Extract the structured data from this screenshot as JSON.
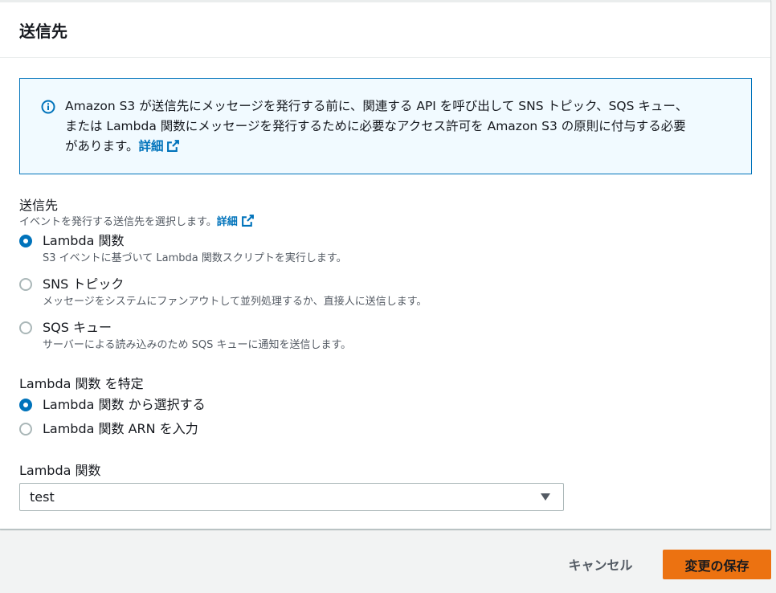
{
  "panel": {
    "title": "送信先"
  },
  "info": {
    "icon": "info-icon",
    "line1": "Amazon S3 が送信先にメッセージを発行する前に、関連する API を呼び出して SNS トピック、SQS キュー、",
    "line2": "または Lambda 関数にメッセージを発行するために必要なアクセス許可を Amazon S3 の原則に付与する必要",
    "line3": "があります。",
    "link": "詳細"
  },
  "destination": {
    "label": "送信先",
    "description": "イベントを発行する送信先を選択します。",
    "link": "詳細",
    "options": [
      {
        "label": "Lambda 関数",
        "description": "S3 イベントに基づいて Lambda 関数スクリプトを実行します。",
        "checked": true
      },
      {
        "label": "SNS トピック",
        "description": "メッセージをシステムにファンアウトして並列処理するか、直接人に送信します。",
        "checked": false
      },
      {
        "label": "SQS キュー",
        "description": "サーバーによる読み込みのため SQS キューに通知を送信します。",
        "checked": false
      }
    ]
  },
  "lambda_specify": {
    "label": "Lambda 関数 を特定",
    "options": [
      {
        "label": "Lambda 関数 から選択する",
        "checked": true
      },
      {
        "label": "Lambda 関数 ARN を入力",
        "checked": false
      }
    ]
  },
  "lambda_function": {
    "label": "Lambda 関数",
    "selected": "test"
  },
  "footer": {
    "cancel": "キャンセル",
    "save": "変更の保存"
  },
  "colors": {
    "accent": "#0073bb",
    "primary_button": "#ec7211",
    "info_background": "#f1faff"
  }
}
